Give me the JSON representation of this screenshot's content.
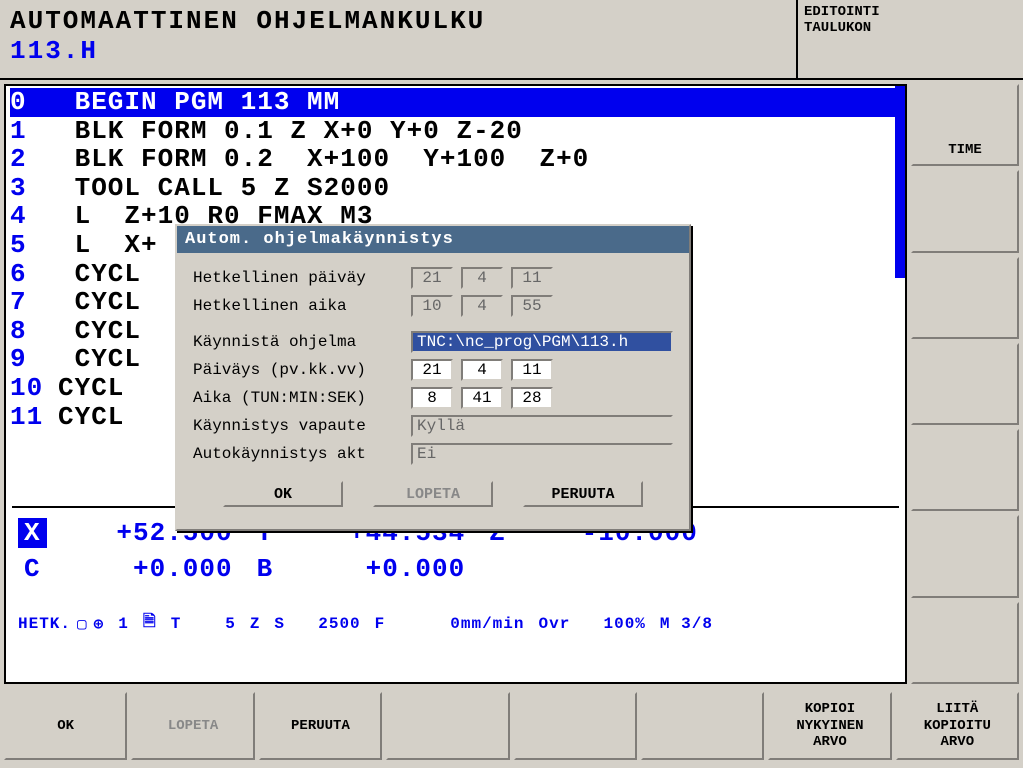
{
  "header": {
    "title": "AUTOMAATTINEN OHJELMANKULKU",
    "program": "113.H",
    "mode_line1": "EDITOINTI",
    "mode_line2": "TAULUKON"
  },
  "program_lines": [
    {
      "n": "0",
      "text": " BEGIN PGM 113 MM",
      "hl": true
    },
    {
      "n": "1",
      "text": " BLK FORM 0.1 Z X+0 Y+0 Z-20"
    },
    {
      "n": "2",
      "text": " BLK FORM 0.2  X+100  Y+100  Z+0"
    },
    {
      "n": "3",
      "text": " TOOL CALL 5 Z S2000"
    },
    {
      "n": "4",
      "text": " L  Z+10 R0 FMAX M3"
    },
    {
      "n": "5",
      "text": " L  X+"
    },
    {
      "n": "6",
      "text": " CYCL"
    },
    {
      "n": "7",
      "text": " CYCL"
    },
    {
      "n": "8",
      "text": " CYCL"
    },
    {
      "n": "9",
      "text": " CYCL"
    },
    {
      "n": "10",
      "text": "CYCL"
    },
    {
      "n": "11",
      "text": "CYCL"
    }
  ],
  "sidebar": [
    "TIME",
    "",
    "",
    "",
    "",
    "",
    ""
  ],
  "dro": {
    "row1": [
      {
        "label": "X",
        "value": "+52.500",
        "hl": true
      },
      {
        "label": "Y",
        "value": "+44.534"
      },
      {
        "label": "Z",
        "value": "-10.000"
      }
    ],
    "row2": [
      {
        "label": "C",
        "value": "+0.000"
      },
      {
        "label": "B",
        "value": "+0.000"
      }
    ]
  },
  "status": {
    "hetk": "HETK.",
    "datum": "1",
    "t": "T",
    "t_val": "5",
    "z": "Z",
    "s": "S",
    "s_val": "2500",
    "f": "F",
    "f_val": "0mm/min",
    "ovr": "Ovr",
    "ovr_val": "100%",
    "m": "M 3/8"
  },
  "softkeys": [
    {
      "label": "OK",
      "disabled": false
    },
    {
      "label": "LOPETA",
      "disabled": true
    },
    {
      "label": "PERUUTA",
      "disabled": false
    },
    {
      "label": "",
      "empty": true
    },
    {
      "label": "",
      "empty": true
    },
    {
      "label": "",
      "empty": true
    },
    {
      "label": "KOPIOI\nNYKYINEN\nARVO",
      "disabled": false
    },
    {
      "label": "LIITÄ\nKOPIOITU\nARVO",
      "disabled": false
    }
  ],
  "dialog": {
    "title": "Autom. ohjelmakäynnistys",
    "rows": {
      "cur_date_label": "Hetkellinen päiväy",
      "cur_date": {
        "d": "21",
        "m": "4",
        "y": "11"
      },
      "cur_time_label": "Hetkellinen aika",
      "cur_time": {
        "h": "10",
        "m": "4",
        "s": "55"
      },
      "prog_label": "Käynnistä ohjelma",
      "prog_path": "TNC:\\nc_prog\\PGM\\113.h",
      "date_label": "Päiväys (pv.kk.vv)",
      "date": {
        "d": "21",
        "m": "4",
        "y": "11"
      },
      "time_label": "Aika (TUN:MIN:SEK)",
      "time": {
        "h": "8",
        "m": "41",
        "s": "28"
      },
      "release_label": "Käynnistys vapaute",
      "release_val": "Kyllä",
      "auto_label": "Autokäynnistys akt",
      "auto_val": "Ei"
    },
    "buttons": {
      "ok": "OK",
      "stop": "LOPETA",
      "cancel": "PERUUTA"
    }
  }
}
